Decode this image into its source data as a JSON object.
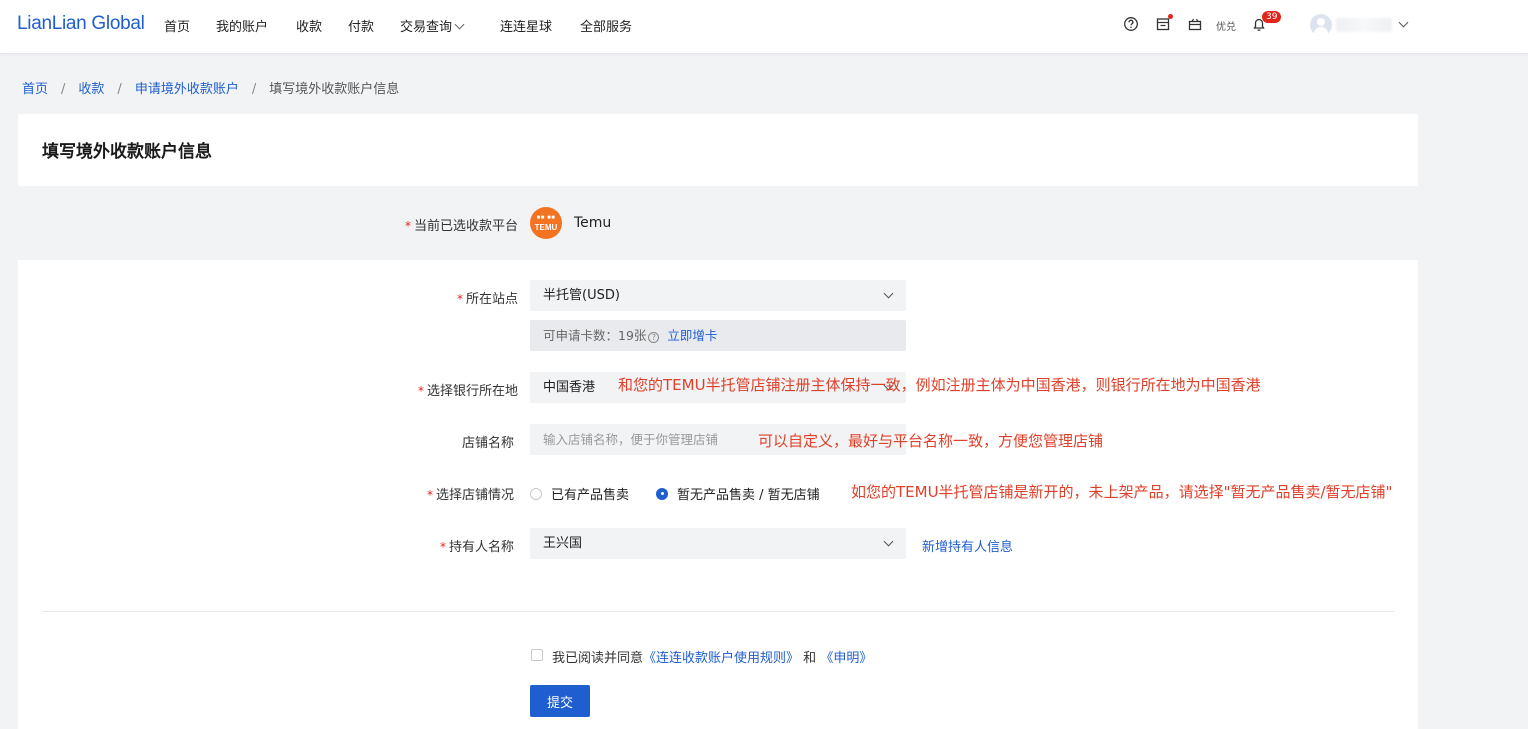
{
  "nav": {
    "logo": "LianLian Global",
    "items": [
      "首页",
      "我的账户",
      "收款",
      "付款",
      "交易查询",
      "连连星球",
      "全部服务"
    ],
    "coupon": "优兑",
    "notification_count": "39"
  },
  "breadcrumb": [
    "首页",
    "收款",
    "申请境外收款账户",
    "填写境外收款账户信息"
  ],
  "page_title": "填写境外收款账户信息",
  "form": {
    "platform_label": "当前已选收款平台",
    "platform_logo_text": "TEMU",
    "platform_name": "Temu",
    "site_label": "所在站点",
    "site_value": "半托管(USD)",
    "quota_text": "可申请卡数：19张",
    "quota_link": "立即增卡",
    "bank_location_label": "选择银行所在地",
    "bank_location_value": "中国香港",
    "shop_name_label": "店铺名称",
    "shop_name_placeholder": "输入店铺名称，便于你管理店铺",
    "shop_status_label": "选择店铺情况",
    "shop_status_options": [
      "已有产品售卖",
      "暂无产品售卖 / 暂无店铺"
    ],
    "shop_status_selected": 1,
    "holder_label": "持有人名称",
    "holder_value": "王兴国",
    "add_holder_link": "新增持有人信息",
    "agree_text": "我已阅读并同意",
    "agree_link1": "《连连收款账户使用规则》",
    "agree_and": "和",
    "agree_link2": "《申明》",
    "submit_label": "提交"
  },
  "annotations": {
    "bank_location": "和您的TEMU半托管店铺注册主体保持一致，例如注册主体为中国香港，则银行所在地为中国香港",
    "shop_name": "可以自定义，最好与平台名称一致，方便您管理店铺",
    "shop_status": "如您的TEMU半托管店铺是新开的，未上架产品，请选择\"暂无产品售卖/暂无店铺\""
  },
  "colors": {
    "brand_blue": "#1f5ecf",
    "required_red": "#e1251b",
    "annotation_red": "#e0402a",
    "temu_orange": "#f47321"
  }
}
